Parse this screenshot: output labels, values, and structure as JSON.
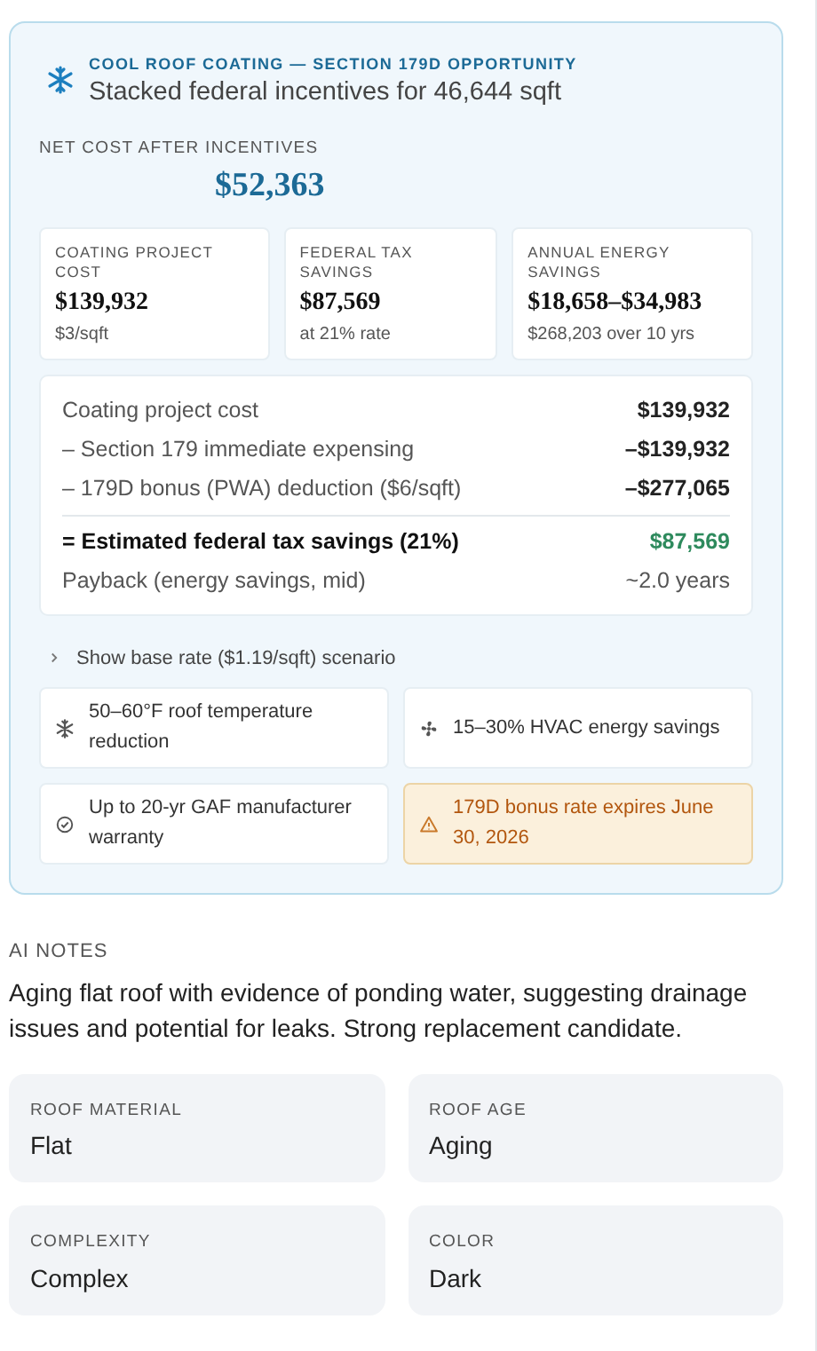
{
  "opportunity": {
    "eyebrow": "COOL ROOF COATING — SECTION 179D OPPORTUNITY",
    "subtitle": "Stacked federal incentives for 46,644 sqft",
    "net_cost": {
      "label": "NET COST AFTER INCENTIVES",
      "value": "$52,363"
    },
    "stats": [
      {
        "label": "COATING PROJECT COST",
        "value": "$139,932",
        "note": "$3/sqft"
      },
      {
        "label": "FEDERAL TAX SAVINGS",
        "value": "$87,569",
        "note": "at 21% rate"
      },
      {
        "label": "ANNUAL ENERGY SAVINGS",
        "value": "$18,658–$34,983",
        "note": "$268,203 over 10 yrs"
      }
    ],
    "breakdown": [
      {
        "kind": "line",
        "label": "Coating project cost",
        "value": "$139,932"
      },
      {
        "kind": "line",
        "label": "– Section 179 immediate expensing",
        "value": "–$139,932"
      },
      {
        "kind": "line",
        "label": "– 179D bonus (PWA) deduction ($6/sqft)",
        "value": "–$277,065"
      },
      {
        "kind": "total",
        "label": "= Estimated federal tax savings (21%)",
        "value": "$87,569"
      },
      {
        "kind": "line",
        "label": "Payback (energy savings, mid)",
        "value": "~2.0 years"
      }
    ],
    "toggle": {
      "label": "Show base rate ($1.19/sqft) scenario",
      "expanded": false
    },
    "benefits": [
      {
        "kind": "snowflake",
        "text": "50–60°F roof temperature reduction"
      },
      {
        "kind": "fan",
        "text": "15–30% HVAC energy savings"
      },
      {
        "kind": "check",
        "text": "Up to 20-yr GAF manufacturer warranty"
      },
      {
        "kind": "warning",
        "text": "179D bonus rate expires June 30, 2026"
      }
    ]
  },
  "ai_notes": {
    "heading": "AI NOTES",
    "text": "Aging flat roof with evidence of ponding water, suggesting drainage issues and potential for leaks. Strong replacement candidate."
  },
  "attributes": [
    {
      "label": "ROOF MATERIAL",
      "value": "Flat"
    },
    {
      "label": "ROOF AGE",
      "value": "Aging"
    },
    {
      "label": "COMPLEXITY",
      "value": "Complex"
    },
    {
      "label": "COLOR",
      "value": "Dark"
    }
  ]
}
